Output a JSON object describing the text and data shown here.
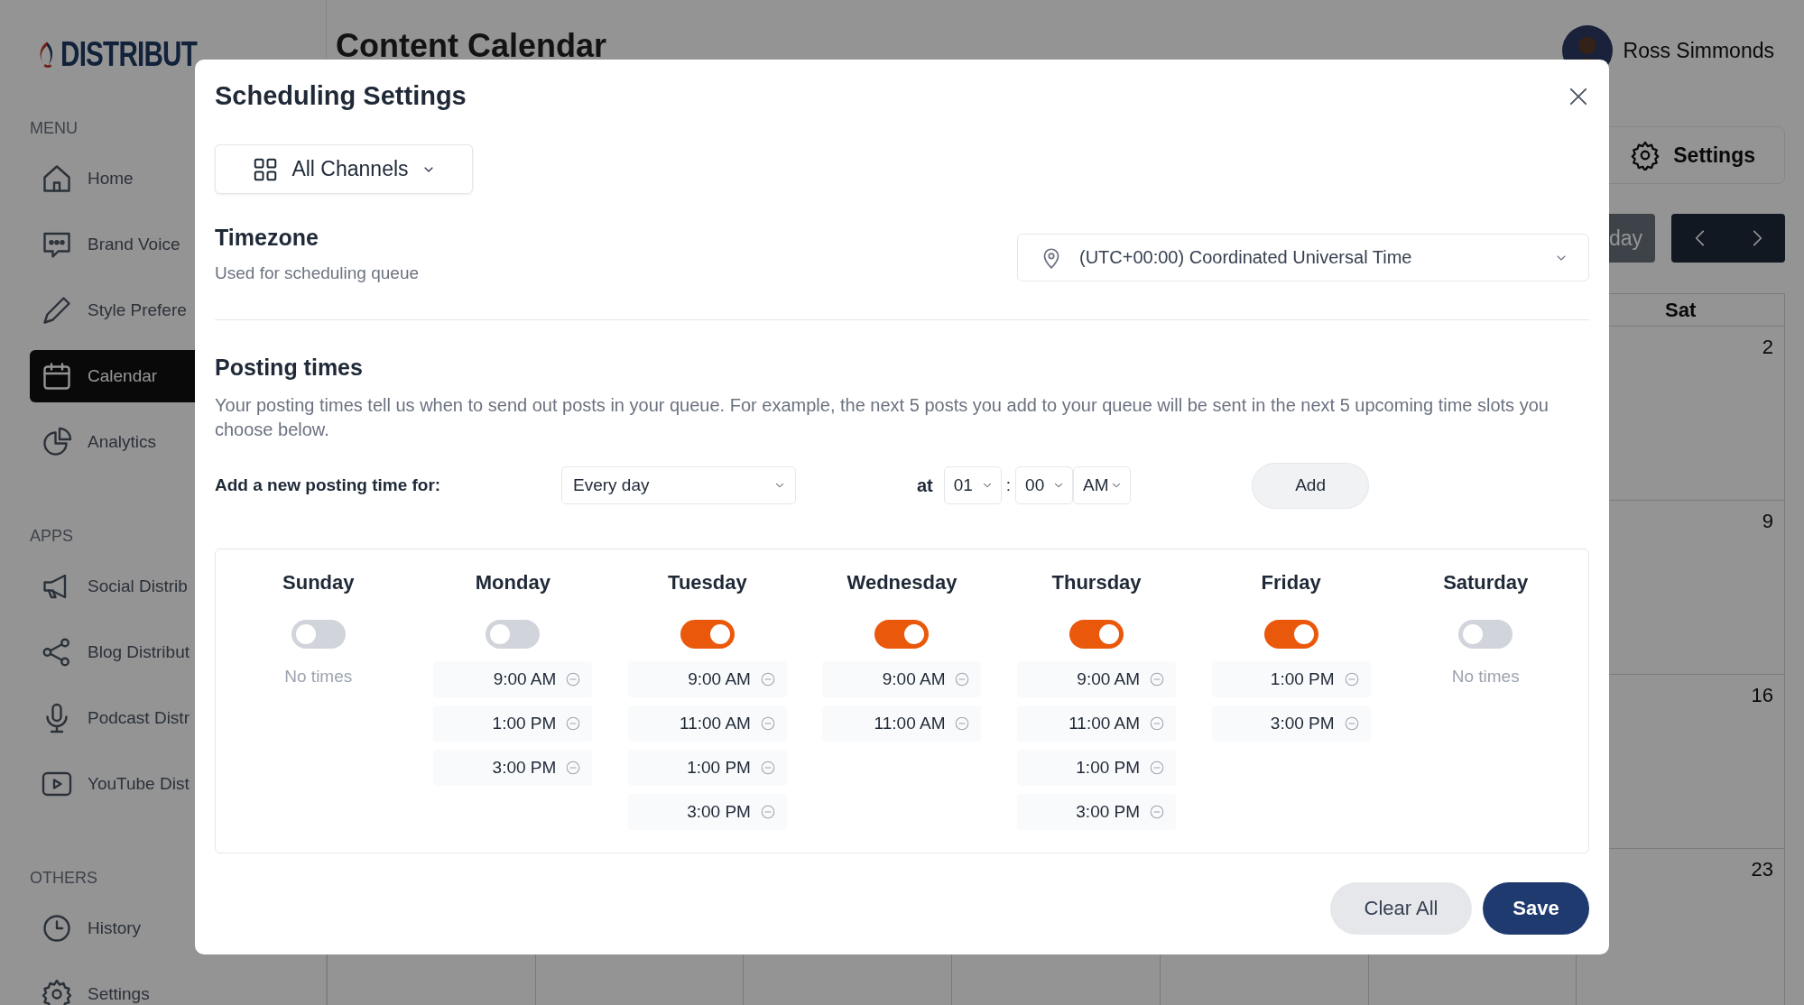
{
  "app": {
    "logo": "DISTRIBUT",
    "page_title": "Content Calendar",
    "user": {
      "name": "Ross Simmonds"
    }
  },
  "sidebar": {
    "sections": [
      {
        "label": "MENU",
        "items": [
          {
            "label": "Home",
            "selected": false
          },
          {
            "label": "Brand Voice",
            "selected": false
          },
          {
            "label": "Style Prefere",
            "selected": false
          },
          {
            "label": "Calendar",
            "selected": true
          },
          {
            "label": "Analytics",
            "selected": false
          }
        ]
      },
      {
        "label": "APPS",
        "items": [
          {
            "label": "Social Distrib",
            "selected": false
          },
          {
            "label": "Blog Distribut",
            "selected": false
          },
          {
            "label": "Podcast Distr",
            "selected": false
          },
          {
            "label": "YouTube Dist",
            "selected": false
          }
        ]
      },
      {
        "label": "OTHERS",
        "items": [
          {
            "label": "History",
            "selected": false
          },
          {
            "label": "Settings",
            "selected": false
          }
        ]
      }
    ]
  },
  "toolbar": {
    "settings_button": "Settings",
    "today_button": "day"
  },
  "calendar": {
    "column_7": "Sat",
    "dates": [
      "2",
      "9",
      "16",
      "23"
    ]
  },
  "modal": {
    "title": "Scheduling Settings",
    "channel_select": "All Channels",
    "timezone": {
      "title": "Timezone",
      "subtitle": "Used for scheduling queue",
      "value": "(UTC+00:00) Coordinated Universal Time"
    },
    "posting_times": {
      "title": "Posting times",
      "description": "Your posting times tell us when to send out posts in your queue. For example, the next 5 posts you add to your queue will be sent in the next 5 upcoming time slots you choose below.",
      "add_label": "Add a new posting time for:",
      "day_select": "Every day",
      "at_label": "at",
      "hour": "01",
      "separator": ":",
      "minute": "00",
      "period": "AM",
      "add_button": "Add"
    },
    "days": [
      {
        "name": "Sunday",
        "on": false,
        "empty_text": "No times"
      },
      {
        "name": "Monday",
        "on": false,
        "times": [
          "9:00 AM",
          "1:00 PM",
          "3:00 PM"
        ]
      },
      {
        "name": "Tuesday",
        "on": true,
        "times": [
          "9:00 AM",
          "11:00 AM",
          "1:00 PM",
          "3:00 PM"
        ]
      },
      {
        "name": "Wednesday",
        "on": true,
        "times": [
          "9:00 AM",
          "11:00 AM"
        ]
      },
      {
        "name": "Thursday",
        "on": true,
        "times": [
          "9:00 AM",
          "11:00 AM",
          "1:00 PM",
          "3:00 PM"
        ]
      },
      {
        "name": "Friday",
        "on": true,
        "times": [
          "1:00 PM",
          "3:00 PM"
        ]
      },
      {
        "name": "Saturday",
        "on": false,
        "empty_text": "No times"
      }
    ],
    "buttons": {
      "clear": "Clear All",
      "save": "Save"
    }
  }
}
